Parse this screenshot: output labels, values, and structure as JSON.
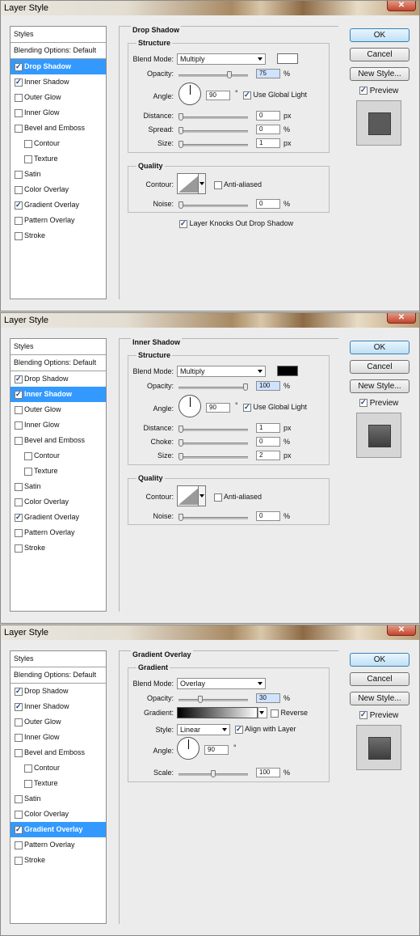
{
  "dialogs": [
    {
      "title": "Layer Style",
      "styles_header": "Styles",
      "blending_options": "Blending Options: Default",
      "style_items": [
        {
          "label": "Drop Shadow",
          "checked": true,
          "selected": true,
          "sub": false
        },
        {
          "label": "Inner Shadow",
          "checked": true,
          "selected": false,
          "sub": false
        },
        {
          "label": "Outer Glow",
          "checked": false,
          "selected": false,
          "sub": false
        },
        {
          "label": "Inner Glow",
          "checked": false,
          "selected": false,
          "sub": false
        },
        {
          "label": "Bevel and Emboss",
          "checked": false,
          "selected": false,
          "sub": false
        },
        {
          "label": "Contour",
          "checked": false,
          "selected": false,
          "sub": true
        },
        {
          "label": "Texture",
          "checked": false,
          "selected": false,
          "sub": true
        },
        {
          "label": "Satin",
          "checked": false,
          "selected": false,
          "sub": false
        },
        {
          "label": "Color Overlay",
          "checked": false,
          "selected": false,
          "sub": false
        },
        {
          "label": "Gradient Overlay",
          "checked": true,
          "selected": false,
          "sub": false
        },
        {
          "label": "Pattern Overlay",
          "checked": false,
          "selected": false,
          "sub": false
        },
        {
          "label": "Stroke",
          "checked": false,
          "selected": false,
          "sub": false
        }
      ],
      "panel_title": "Drop Shadow",
      "group1_title": "Structure",
      "blend_mode_label": "Blend Mode:",
      "blend_mode": "Multiply",
      "swatch_color": "#ffffff",
      "opacity_label": "Opacity:",
      "opacity": "75",
      "opacity_unit": "%",
      "opacity_frac": 0.75,
      "angle_label": "Angle:",
      "angle": "90",
      "angle_unit": "°",
      "global_light_label": "Use Global Light",
      "global_light": true,
      "distance_label": "Distance:",
      "distance": "0",
      "distance_unit": "px",
      "spread_label": "Spread:",
      "spread": "0",
      "spread_unit": "%",
      "size_label": "Size:",
      "size": "1",
      "size_unit": "px",
      "quality_title": "Quality",
      "contour_label": "Contour:",
      "anti_aliased_label": "Anti-aliased",
      "noise_label": "Noise:",
      "noise": "0",
      "noise_unit": "%",
      "knockout_label": "Layer Knocks Out Drop Shadow",
      "knockout": true
    },
    {
      "title": "Layer Style",
      "styles_header": "Styles",
      "blending_options": "Blending Options: Default",
      "style_items": [
        {
          "label": "Drop Shadow",
          "checked": true,
          "selected": false,
          "sub": false
        },
        {
          "label": "Inner Shadow",
          "checked": true,
          "selected": true,
          "sub": false
        },
        {
          "label": "Outer Glow",
          "checked": false,
          "selected": false,
          "sub": false
        },
        {
          "label": "Inner Glow",
          "checked": false,
          "selected": false,
          "sub": false
        },
        {
          "label": "Bevel and Emboss",
          "checked": false,
          "selected": false,
          "sub": false
        },
        {
          "label": "Contour",
          "checked": false,
          "selected": false,
          "sub": true
        },
        {
          "label": "Texture",
          "checked": false,
          "selected": false,
          "sub": true
        },
        {
          "label": "Satin",
          "checked": false,
          "selected": false,
          "sub": false
        },
        {
          "label": "Color Overlay",
          "checked": false,
          "selected": false,
          "sub": false
        },
        {
          "label": "Gradient Overlay",
          "checked": true,
          "selected": false,
          "sub": false
        },
        {
          "label": "Pattern Overlay",
          "checked": false,
          "selected": false,
          "sub": false
        },
        {
          "label": "Stroke",
          "checked": false,
          "selected": false,
          "sub": false
        }
      ],
      "panel_title": "Inner Shadow",
      "group1_title": "Structure",
      "blend_mode_label": "Blend Mode:",
      "blend_mode": "Multiply",
      "swatch_color": "#000000",
      "opacity_label": "Opacity:",
      "opacity": "100",
      "opacity_unit": "%",
      "opacity_frac": 1.0,
      "angle_label": "Angle:",
      "angle": "90",
      "angle_unit": "°",
      "global_light_label": "Use Global Light",
      "global_light": true,
      "distance_label": "Distance:",
      "distance": "1",
      "distance_unit": "px",
      "spread_label": "Choke:",
      "spread": "0",
      "spread_unit": "%",
      "size_label": "Size:",
      "size": "2",
      "size_unit": "px",
      "quality_title": "Quality",
      "contour_label": "Contour:",
      "anti_aliased_label": "Anti-aliased",
      "noise_label": "Noise:",
      "noise": "0",
      "noise_unit": "%"
    },
    {
      "title": "Layer Style",
      "styles_header": "Styles",
      "blending_options": "Blending Options: Default",
      "style_items": [
        {
          "label": "Drop Shadow",
          "checked": true,
          "selected": false,
          "sub": false
        },
        {
          "label": "Inner Shadow",
          "checked": true,
          "selected": false,
          "sub": false
        },
        {
          "label": "Outer Glow",
          "checked": false,
          "selected": false,
          "sub": false
        },
        {
          "label": "Inner Glow",
          "checked": false,
          "selected": false,
          "sub": false
        },
        {
          "label": "Bevel and Emboss",
          "checked": false,
          "selected": false,
          "sub": false
        },
        {
          "label": "Contour",
          "checked": false,
          "selected": false,
          "sub": true
        },
        {
          "label": "Texture",
          "checked": false,
          "selected": false,
          "sub": true
        },
        {
          "label": "Satin",
          "checked": false,
          "selected": false,
          "sub": false
        },
        {
          "label": "Color Overlay",
          "checked": false,
          "selected": false,
          "sub": false
        },
        {
          "label": "Gradient Overlay",
          "checked": true,
          "selected": true,
          "sub": false
        },
        {
          "label": "Pattern Overlay",
          "checked": false,
          "selected": false,
          "sub": false
        },
        {
          "label": "Stroke",
          "checked": false,
          "selected": false,
          "sub": false
        }
      ],
      "panel_title": "Gradient Overlay",
      "group1_title": "Gradient",
      "blend_mode_label": "Blend Mode:",
      "blend_mode": "Overlay",
      "opacity_label": "Opacity:",
      "opacity": "30",
      "opacity_unit": "%",
      "opacity_frac": 0.3,
      "gradient_label": "Gradient:",
      "reverse_label": "Reverse",
      "reverse": false,
      "style_label": "Style:",
      "style_value": "Linear",
      "align_label": "Align with Layer",
      "align": true,
      "angle_label": "Angle:",
      "angle": "90",
      "angle_unit": "°",
      "scale_label": "Scale:",
      "scale": "100",
      "scale_unit": "%",
      "scale_frac": 0.5
    }
  ],
  "buttons": {
    "ok": "OK",
    "cancel": "Cancel",
    "new_style": "New Style...",
    "preview": "Preview"
  }
}
